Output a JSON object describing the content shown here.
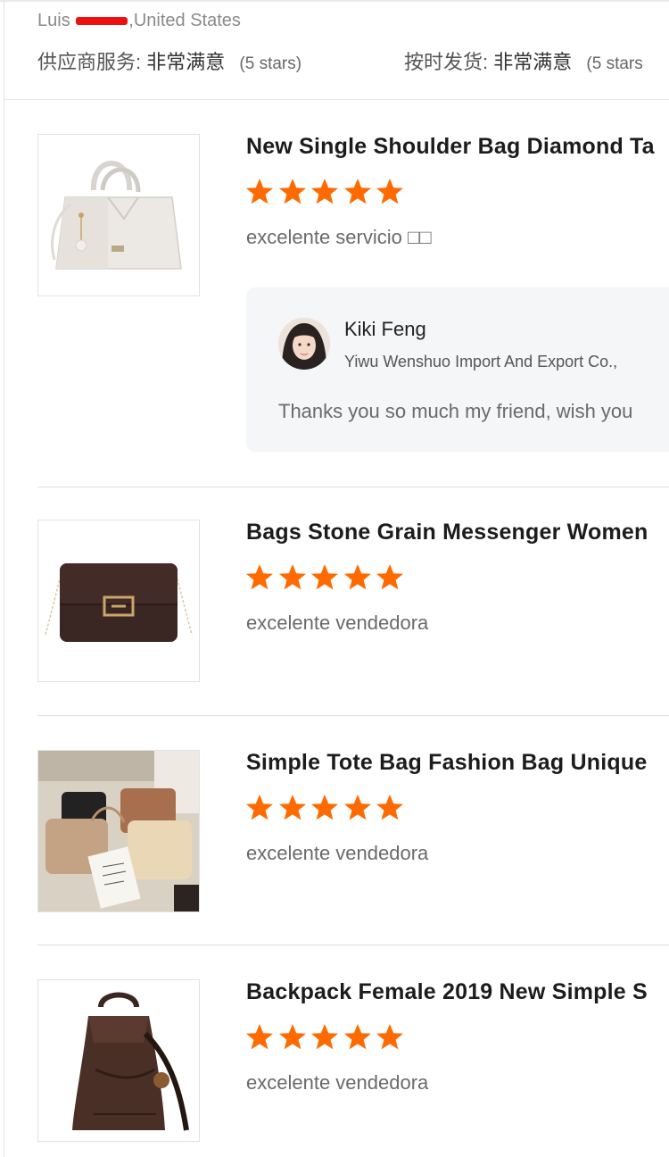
{
  "buyer": {
    "first_name": "Luis",
    "country": ",United States"
  },
  "store_ratings": [
    {
      "label": "供应商服务:",
      "value": "非常满意",
      "stars": "(5 stars)"
    },
    {
      "label": "按时发货:",
      "value": "非常满意",
      "stars": "(5 stars"
    }
  ],
  "reviews": [
    {
      "title": "New Single Shoulder Bag Diamond Ta",
      "rating": 5,
      "comment": "excelente servicio □□",
      "image": "white-handbag"
    },
    {
      "title": "Bags Stone Grain Messenger Women",
      "rating": 5,
      "comment": "excelente vendedora",
      "image": "brown-crossbody-bag"
    },
    {
      "title": "Simple Tote Bag Fashion Bag Unique",
      "rating": 5,
      "comment": "excelente vendedora",
      "image": "tote-bags-flatlay"
    },
    {
      "title": "Backpack Female 2019 New Simple S",
      "rating": 5,
      "comment": "excelente vendedora",
      "image": "brown-backpack"
    }
  ],
  "seller_reply": {
    "name": "Kiki Feng",
    "company": "Yiwu Wenshuo Import And Export Co.,",
    "text": "Thanks you so much my friend, wish you"
  },
  "colors": {
    "star": "#ff6a00",
    "reply_bg": "#f5f6f7",
    "redaction": "#ee1111"
  }
}
